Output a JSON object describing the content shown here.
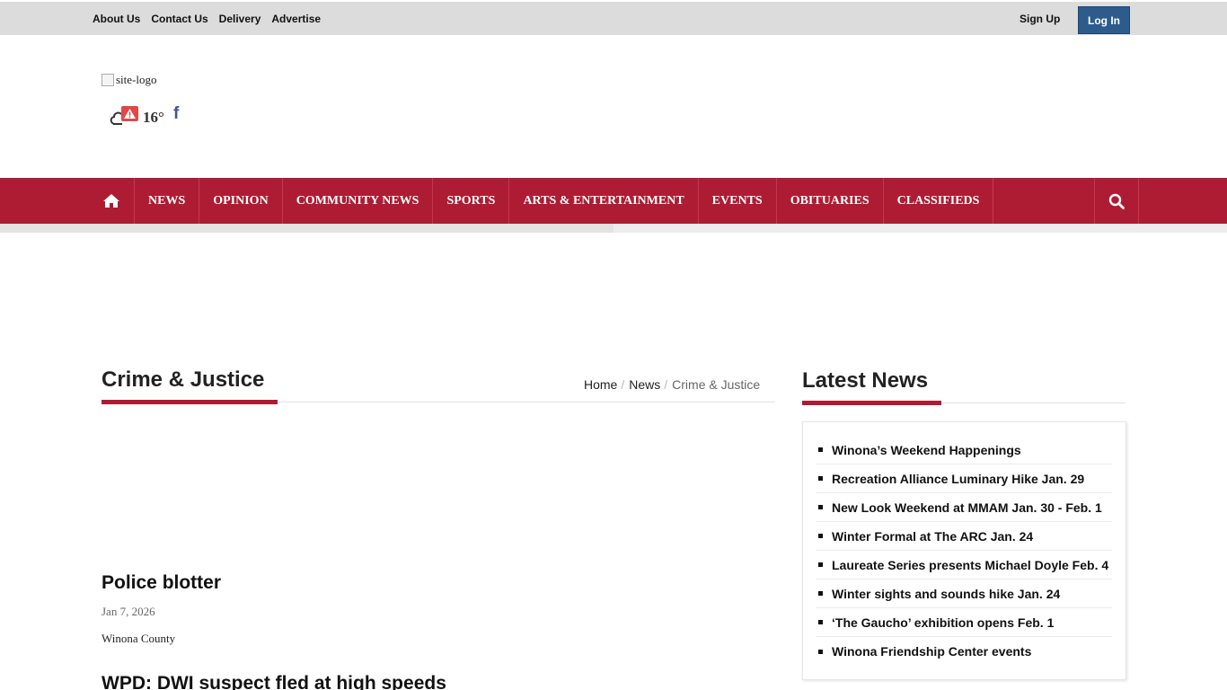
{
  "topbar": {
    "links": [
      "About Us",
      "Contact Us",
      "Delivery",
      "Advertise"
    ],
    "signup": "Sign Up",
    "login": "Log In"
  },
  "header": {
    "logo_alt": "site-logo",
    "weather_icon": "cloud-alert-icon",
    "temperature": "16°",
    "social_icon": "facebook-icon"
  },
  "nav": {
    "home_icon": "home-icon",
    "items": [
      "NEWS",
      "OPINION",
      "COMMUNITY NEWS",
      "SPORTS",
      "ARTS & ENTERTAINMENT",
      "EVENTS",
      "OBITUARIES",
      "CLASSIFIEDS"
    ],
    "search_icon": "search-icon"
  },
  "section": {
    "title": "Crime & Justice",
    "breadcrumb": [
      "Home",
      "News",
      "Crime & Justice"
    ]
  },
  "articles": [
    {
      "title": "Police blotter",
      "date": "Jan 7, 2026",
      "blurb": "Winona County"
    },
    {
      "title": "WPD: DWI suspect fled at high speeds"
    }
  ],
  "latest": {
    "title": "Latest News",
    "items": [
      "Winona’s Weekend Happenings",
      "Recreation Alliance Luminary Hike Jan. 29",
      "New Look Weekend at MMAM Jan. 30 - Feb. 1",
      "Winter Formal at The ARC Jan. 24",
      "Laureate Series presents Michael Doyle Feb. 4",
      "Winter sights and sounds hike Jan. 24",
      "‘The Gaucho’ exhibition opens Feb. 1",
      "Winona Friendship Center events"
    ]
  },
  "colors": {
    "brand_red": "#ae1c33",
    "login_blue": "#2d5b8b",
    "facebook_blue": "#3b5998"
  }
}
